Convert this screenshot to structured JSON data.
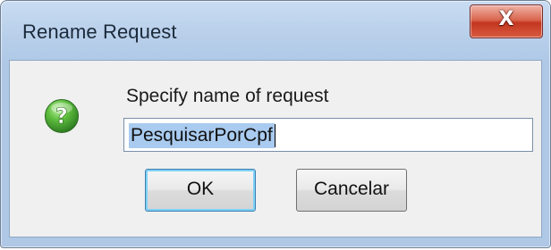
{
  "window": {
    "title": "Rename Request",
    "close_glyph": "X"
  },
  "dialog": {
    "icon": "question-icon",
    "prompt": "Specify name of request",
    "name_field": {
      "value": "PesquisarPorCpf",
      "selected": true
    },
    "buttons": {
      "ok_label": "OK",
      "cancel_label": "Cancelar"
    }
  },
  "colors": {
    "titlebar": "#b8cfea",
    "close_button": "#c2361f",
    "question_icon": "#4aa33a",
    "selection": "#a9cbef"
  }
}
